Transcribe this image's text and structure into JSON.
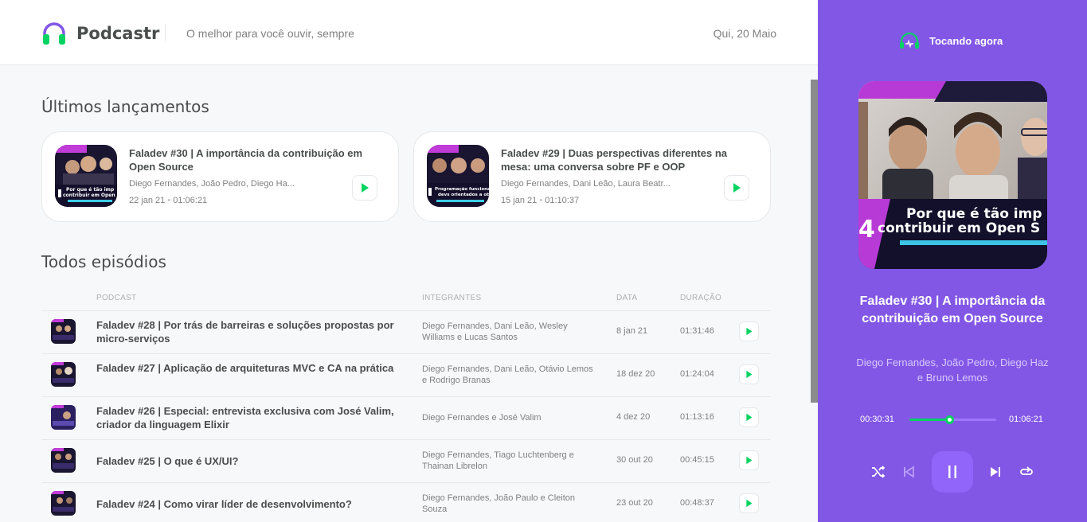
{
  "header": {
    "app_name": "Podcastr",
    "tagline": "O melhor para você ouvir, sempre",
    "date": "Qui, 20 Maio"
  },
  "latest": {
    "title": "Últimos lançamentos",
    "items": [
      {
        "title": "Faladev #30 | A importância da contribuição em Open Source",
        "members": "Diego Fernandes, João Pedro, Diego Ha...",
        "date": "22 jan 21",
        "duration": "01:06:21",
        "thumb_caption": "Por que é tão imp contribuir em Open S"
      },
      {
        "title": "Faladev #29 | Duas perspectivas diferentes na mesa: uma conversa sobre PF e OOP",
        "members": "Diego Fernandes, Dani Leão, Laura Beatr...",
        "date": "15 jan 21",
        "duration": "01:10:37",
        "thumb_caption": "Programação funcional devs orientados a ob"
      }
    ]
  },
  "all": {
    "title": "Todos episódios",
    "columns": {
      "podcast": "PODCAST",
      "members": "INTEGRANTES",
      "date": "DATA",
      "duration": "DURAÇÃO"
    },
    "rows": [
      {
        "title": "Faladev #28 | Por trás de barreiras e soluções propostas por micro-serviços",
        "members": "Diego Fernandes, Dani Leão, Wesley Williams e Lucas Santos",
        "date": "8 jan 21",
        "duration": "01:31:46"
      },
      {
        "title": "Faladev #27 | Aplicação de arquiteturas MVC e CA na prática",
        "members": "Diego Fernandes, Dani Leão, Otávio Lemos e Rodrigo Branas",
        "date": "18 dez 20",
        "duration": "01:24:04"
      },
      {
        "title": "Faladev #26 | Especial: entrevista exclusiva com José Valim, criador da linguagem Elixir",
        "members": "Diego Fernandes e José Valim",
        "date": "4 dez 20",
        "duration": "01:13:16"
      },
      {
        "title": "Faladev #25 | O que é UX/UI?",
        "members": "Diego Fernandes, Tiago Luchtenberg e Thainan Librelon",
        "date": "30 out 20",
        "duration": "00:45:15"
      },
      {
        "title": "Faladev #24 | Como virar líder de desenvolvimento?",
        "members": "Diego Fernandes, João Paulo e Cleiton Souza",
        "date": "23 out 20",
        "duration": "00:48:37"
      }
    ]
  },
  "player": {
    "label": "Tocando agora",
    "title": "Faladev #30 | A importância da contribuição em Open Source",
    "members": "Diego Fernandes, João Pedro, Diego Haz e Bruno Lemos",
    "cover_caption_line1": "Por que é tão imp",
    "cover_caption_line2": "contribuir em Open S",
    "cover_number": "4",
    "current_time": "00:30:31",
    "total_time": "01:06:21",
    "progress": 0.46
  },
  "colors": {
    "purple": "#8257e5",
    "green": "#04d361",
    "text": "#494d4b",
    "muted": "#808080"
  }
}
